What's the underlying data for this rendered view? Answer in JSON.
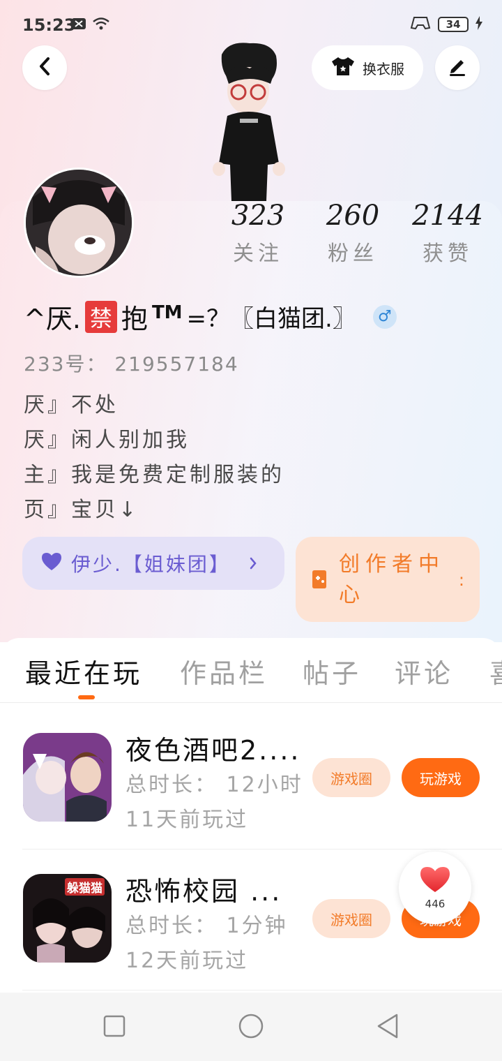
{
  "status_bar": {
    "time": "15:23",
    "battery": "34"
  },
  "header": {
    "outfit_label": "换衣服"
  },
  "stats": [
    {
      "value": "323",
      "label": "关注"
    },
    {
      "value": "260",
      "label": "粉丝"
    },
    {
      "value": "2144",
      "label": "获赞"
    }
  ],
  "profile": {
    "name_prefix": "^厌.",
    "ban_char": "禁",
    "name_mid": "抱",
    "name_sup": "TM",
    "name_suffix": "=？〖白猫团.〗",
    "gender": "♂",
    "uid": "233号： 219557184",
    "bio": [
      "厌』不处",
      "厌』闲人别加我",
      "主』我是免费定制服装的",
      "页』宝贝↓"
    ]
  },
  "chips": {
    "group_label": "伊少.【姐妹团】",
    "creator_label": "创作者中心"
  },
  "tabs": [
    "最近在玩",
    "作品栏",
    "帖子",
    "评论",
    "喜"
  ],
  "games": [
    {
      "title": "夜色酒吧2....",
      "duration": "总时长： 12小时",
      "last_played": "11天前玩过",
      "circle_label": "游戏圈",
      "play_label": "玩游戏"
    },
    {
      "title": "恐怖校园 ...",
      "duration": "总时长： 1分钟",
      "last_played": "12天前玩过",
      "circle_label": "游戏圈",
      "play_label": "玩游戏",
      "icon_text": "躲猫猫"
    }
  ],
  "like_float": {
    "count": "446"
  },
  "colors": {
    "accent": "#ff6a13",
    "accent_light": "#fde3d4",
    "purple": "#6a5cd1",
    "ban_red": "#e63b3b"
  }
}
